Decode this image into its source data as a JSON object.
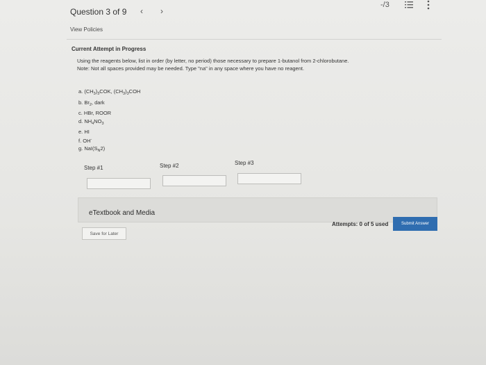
{
  "header": {
    "question_title": "Question 3 of 9",
    "prev_icon": "‹",
    "next_icon": "›",
    "score": "-/3",
    "list_icon": "list-icon",
    "more_icon": "more-vertical-icon"
  },
  "policies_link": "View Policies",
  "attempt_title": "Current Attempt in Progress",
  "instructions": {
    "line1": "Using the reagents below, list in order (by letter, no period) those necessary to prepare 1-butanol from 2-chlorobutane.",
    "line2": "Note: Not all spaces provided may be needed. Type \"na\" in any space where you have no reagent."
  },
  "reagents": {
    "a_prefix": "a. (CH",
    "a_sub1": "3",
    "a_mid": ")",
    "a_sub2": "3",
    "a_mid2": "COK, (CH",
    "a_sub3": "3",
    "a_mid3": ")",
    "a_sub4": "3",
    "a_end": "COH",
    "b_prefix": "b. Br",
    "b_sub": "2",
    "b_end": ", dark",
    "c": "c. HBr, ROOR",
    "d_prefix": "d. NH",
    "d_sub1": "4",
    "d_mid": "NO",
    "d_sub2": "3",
    "e": "e. HI",
    "f_prefix": "f. OH",
    "f_sup": "-",
    "g_prefix": "g. NaI(S",
    "g_sub": "N",
    "g_end": "2)"
  },
  "steps": [
    {
      "label": "Step #1",
      "value": ""
    },
    {
      "label": "Step #2",
      "value": ""
    },
    {
      "label": "Step #3",
      "value": ""
    }
  ],
  "resources_label": "eTextbook and Media",
  "attempts_text": "Attempts: 0 of 5 used",
  "submit_label": "Submit Answer",
  "save_label": "Save for Later",
  "colors": {
    "submit_bg": "#2f6db0",
    "page_bg": "#e9e9e7"
  }
}
